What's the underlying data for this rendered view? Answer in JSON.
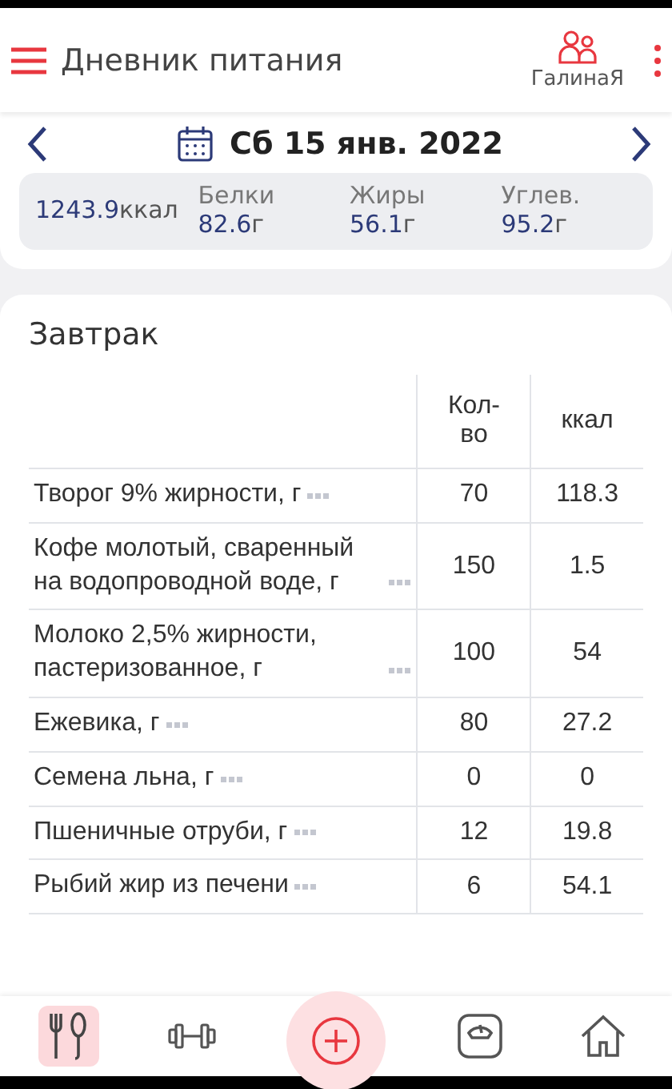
{
  "header": {
    "title": "Дневник питания",
    "profile": "ГалинаЯ"
  },
  "date": {
    "label": "Сб 15 янв. 2022"
  },
  "summary": {
    "kcal": "1243.9",
    "kcal_unit": "ккал",
    "macros": [
      {
        "label": "Белки",
        "value": "82.6",
        "unit": "г"
      },
      {
        "label": "Жиры",
        "value": "56.1",
        "unit": "г"
      },
      {
        "label": "Углев.",
        "value": "95.2",
        "unit": "г"
      }
    ]
  },
  "meal": {
    "title": "Завтрак",
    "columns": [
      "Кол-во",
      "ккал"
    ],
    "rows": [
      {
        "name": "Творог 9% жирности, г",
        "qty": "70",
        "kcal": "118.3"
      },
      {
        "name": "Кофе молотый, сваренный на водопроводной воде, г",
        "qty": "150",
        "kcal": "1.5"
      },
      {
        "name": "Молоко 2,5% жирности, пастеризованное, г",
        "qty": "100",
        "kcal": "54"
      },
      {
        "name": "Ежевика, г",
        "qty": "80",
        "kcal": "27.2"
      },
      {
        "name": "Семена льна, г",
        "qty": "0",
        "kcal": "0"
      },
      {
        "name": "Пшеничные отруби, г",
        "qty": "12",
        "kcal": "19.8"
      },
      {
        "name": "Рыбий жир из печени",
        "qty": "6",
        "kcal": "54.1"
      }
    ]
  },
  "nav_items": [
    {
      "kind": "food",
      "selected": true
    },
    {
      "kind": "sport",
      "selected": false
    },
    {
      "kind": "add",
      "selected": false
    },
    {
      "kind": "scale",
      "selected": false
    },
    {
      "kind": "home",
      "selected": false
    }
  ]
}
